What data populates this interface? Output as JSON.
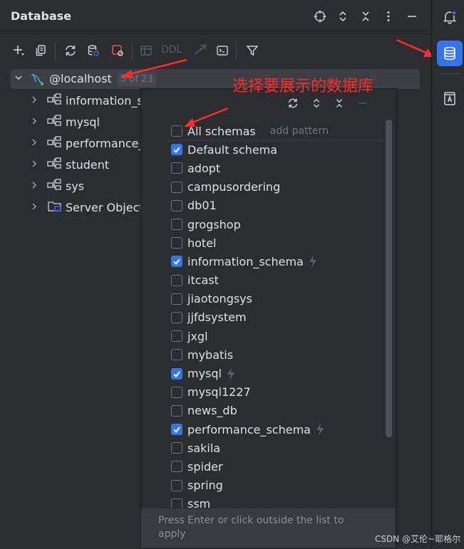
{
  "header": {
    "title": "Database"
  },
  "toolbar": {
    "ddl_label": "DDL"
  },
  "tree": {
    "root": {
      "label": "@localhost",
      "badge": "5 of 23"
    },
    "items": [
      {
        "label": "information_s"
      },
      {
        "label": "mysql"
      },
      {
        "label": "performance_"
      },
      {
        "label": "student"
      },
      {
        "label": "sys"
      },
      {
        "label": "Server Object"
      }
    ]
  },
  "annotation": "选择要展示的数据库",
  "schema_popup": {
    "all_schemas": {
      "label": "All schemas",
      "checked": false,
      "add_pattern": "add pattern"
    },
    "schemas": [
      {
        "name": "Default schema",
        "checked": true,
        "bolt": false
      },
      {
        "name": "adopt",
        "checked": false,
        "bolt": false
      },
      {
        "name": "campusordering",
        "checked": false,
        "bolt": false
      },
      {
        "name": "db01",
        "checked": false,
        "bolt": false
      },
      {
        "name": "grogshop",
        "checked": false,
        "bolt": false
      },
      {
        "name": "hotel",
        "checked": false,
        "bolt": false
      },
      {
        "name": "information_schema",
        "checked": true,
        "bolt": true
      },
      {
        "name": "itcast",
        "checked": false,
        "bolt": false
      },
      {
        "name": "jiaotongsys",
        "checked": false,
        "bolt": false
      },
      {
        "name": "jjfdsystem",
        "checked": false,
        "bolt": false
      },
      {
        "name": "jxgl",
        "checked": false,
        "bolt": false
      },
      {
        "name": "mybatis",
        "checked": false,
        "bolt": false
      },
      {
        "name": "mysql",
        "checked": true,
        "bolt": true
      },
      {
        "name": "mysql1227",
        "checked": false,
        "bolt": false
      },
      {
        "name": "news_db",
        "checked": false,
        "bolt": false
      },
      {
        "name": "performance_schema",
        "checked": true,
        "bolt": true
      },
      {
        "name": "sakila",
        "checked": false,
        "bolt": false
      },
      {
        "name": "spider",
        "checked": false,
        "bolt": false
      },
      {
        "name": "spring",
        "checked": false,
        "bolt": false
      },
      {
        "name": "ssm",
        "checked": false,
        "bolt": false
      }
    ],
    "footer": "Press Enter or click outside the list to apply"
  },
  "watermark": "CSDN @艾伦~耶格尔",
  "colors": {
    "accent": "#3574f0",
    "annotation": "#ff2a2a",
    "background": "#2b2d30"
  }
}
